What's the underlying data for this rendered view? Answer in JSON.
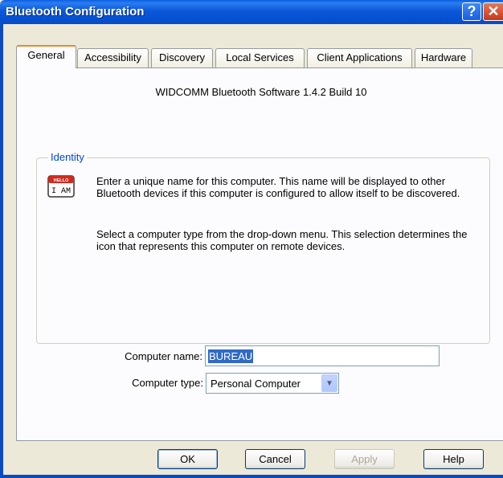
{
  "window": {
    "title": "Bluetooth Configuration"
  },
  "titlebar_buttons": {
    "help": "?",
    "close": "✕"
  },
  "tabs": [
    {
      "label": "General",
      "active": true
    },
    {
      "label": "Accessibility",
      "active": false
    },
    {
      "label": "Discovery",
      "active": false
    },
    {
      "label": "Local Services",
      "active": false
    },
    {
      "label": "Client Applications",
      "active": false
    },
    {
      "label": "Hardware",
      "active": false
    }
  ],
  "general": {
    "version_text": "WIDCOMM Bluetooth Software 1.4.2 Build 10",
    "identity": {
      "group_title": "Identity",
      "icon": "hello-i-am-name-tag-icon",
      "icon_text_top": "HELLO",
      "icon_text": "I AM",
      "para1": "Enter a unique name for this computer.  This name will be displayed to other Bluetooth devices if this computer is configured to allow itself to be discovered.",
      "para2": "Select a computer type from the drop-down menu.  This selection determines the icon that represents this computer on remote devices.",
      "computer_name_label": "Computer name:",
      "computer_name_value": "BUREAU",
      "computer_type_label": "Computer type:",
      "computer_type_value": "Personal Computer"
    }
  },
  "buttons": {
    "ok": "OK",
    "cancel": "Cancel",
    "apply": "Apply",
    "help": "Help"
  },
  "colors": {
    "titlebar": "#0a58d8",
    "active_tab_accent": "#e68b2c",
    "group_title": "#0046d5",
    "selection": "#316ac5"
  }
}
